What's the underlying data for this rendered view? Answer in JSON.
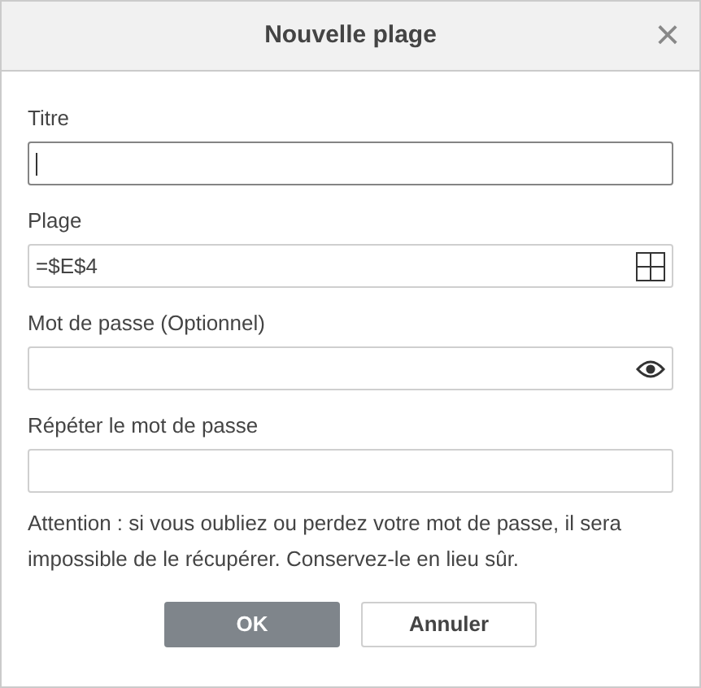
{
  "window": {
    "title": "Nouvelle plage",
    "close": "×"
  },
  "fields": [
    {
      "label": "Titre",
      "kind": "text",
      "focused": true
    },
    {
      "label": "Plage",
      "value": "=$E$4",
      "kind": "range",
      "focused": false
    },
    {
      "label": "Mot de passe (Optionnel)",
      "kind": "password",
      "focused": false
    },
    {
      "label": "Répéter le mot de passe",
      "kind": "text",
      "focused": false
    }
  ],
  "warning": "Attention : si vous oubliez ou perdez votre mot de passe, il sera impossible de le récupérer. Conservez-le en lieu sûr.",
  "buttons": [
    {
      "label": "OK",
      "kind": "primary"
    },
    {
      "label": "Annuler",
      "kind": "secondary"
    }
  ]
}
